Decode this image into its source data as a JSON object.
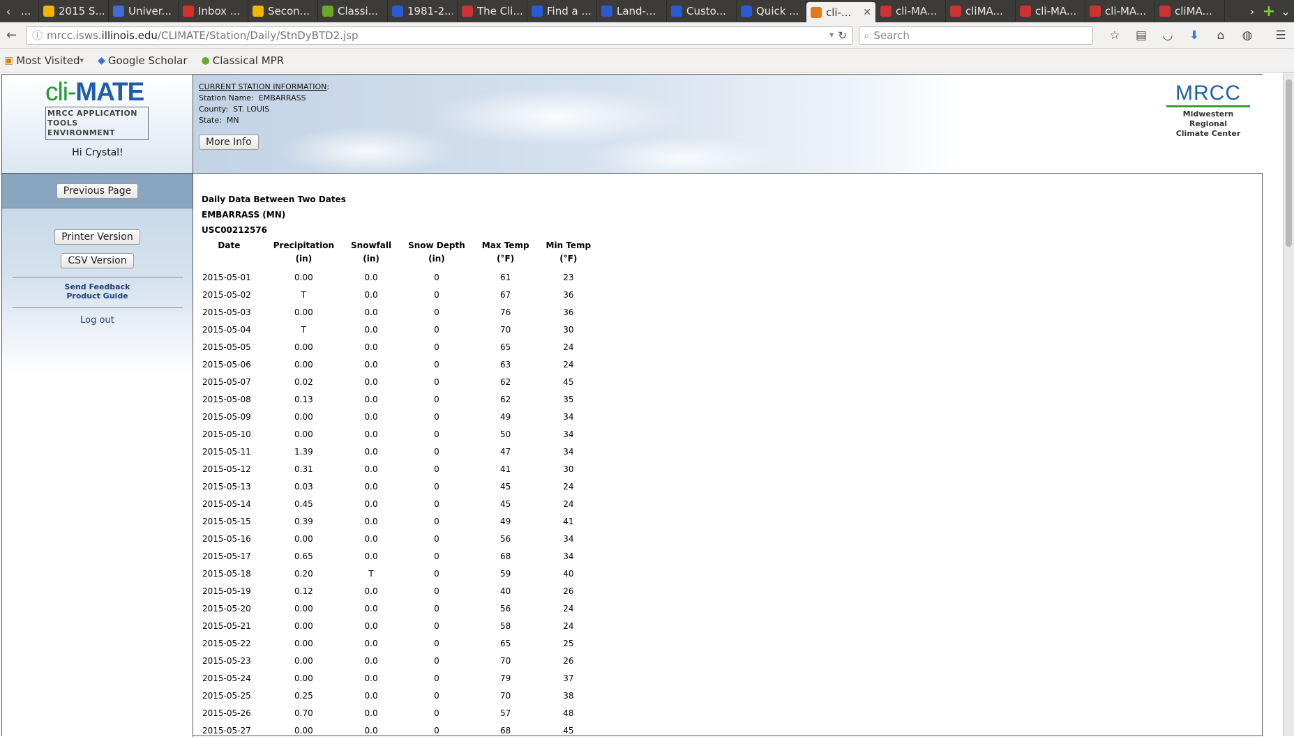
{
  "browser": {
    "tabs": [
      {
        "label": "...",
        "icon": "tab-icon",
        "color": "#888888"
      },
      {
        "label": "2015 S...",
        "icon": "google-drive-icon",
        "color": "#f4b400"
      },
      {
        "label": "Univer...",
        "icon": "calendar-icon",
        "color": "#3b6fd6"
      },
      {
        "label": "Inbox ...",
        "icon": "gmail-icon",
        "color": "#d93025"
      },
      {
        "label": "Secon...",
        "icon": "google-drive-icon",
        "color": "#f4b400"
      },
      {
        "label": "Classi...",
        "icon": "classical-mpr-icon",
        "color": "#6aa82b"
      },
      {
        "label": "1981-2...",
        "icon": "noaa-icon",
        "color": "#2a5bd7"
      },
      {
        "label": "The Cli...",
        "icon": "climate-icon",
        "color": "#cc3333"
      },
      {
        "label": "Find a ...",
        "icon": "noaa-icon",
        "color": "#2a5bd7"
      },
      {
        "label": "Land-...",
        "icon": "noaa-icon",
        "color": "#2a5bd7"
      },
      {
        "label": "Custo...",
        "icon": "noaa-icon",
        "color": "#2a5bd7"
      },
      {
        "label": "Quick ...",
        "icon": "noaa-icon",
        "color": "#2a5bd7"
      },
      {
        "label": "cli-...",
        "icon": "climate-icon",
        "color": "#e07a1a",
        "active": true
      },
      {
        "label": "cli-MA...",
        "icon": "climate-icon",
        "color": "#cc3333"
      },
      {
        "label": "cliMA...",
        "icon": "climate-icon",
        "color": "#cc3333"
      },
      {
        "label": "cli-MA...",
        "icon": "climate-icon",
        "color": "#cc3333"
      },
      {
        "label": "cli-MA...",
        "icon": "climate-icon",
        "color": "#cc3333"
      },
      {
        "label": "cliMA...",
        "icon": "climate-icon",
        "color": "#cc3333"
      }
    ],
    "close_glyph": "✕",
    "url_prefix": "mrcc.isws.",
    "url_host": "illinois.edu",
    "url_path": "/CLIMATE/Station/Daily/StnDyBTD2.jsp",
    "search_placeholder": "Search",
    "bookmarks": [
      {
        "label": "Most Visited",
        "icon": "folder-icon"
      },
      {
        "label": "Google Scholar",
        "icon": "google-scholar-icon"
      },
      {
        "label": "Classical MPR",
        "icon": "classical-mpr-icon"
      }
    ]
  },
  "site": {
    "logo_prefix": "cli-",
    "logo_suffix": "MATE",
    "logo_subtitle_line1": "MRCC APPLICATION",
    "logo_subtitle_line2": "TOOLS ENVIRONMENT",
    "greeting": "Hi Crystal!",
    "station_header": "CURRENT STATION INFORMATION",
    "station_header_colon": ":",
    "station_name_label": "Station Name:",
    "station_name": "EMBARRASS",
    "county_label": "County:",
    "county": "ST. LOUIS",
    "state_label": "State:",
    "state": "MN",
    "more_info": "More Info",
    "mrcc_logo": "MRCC",
    "mrcc_line1": "Midwestern Regional",
    "mrcc_line2": "Climate Center"
  },
  "sidebar": {
    "previous_page": "Previous Page",
    "printer_version": "Printer Version",
    "csv_version": "CSV Version",
    "send_feedback": "Send Feedback",
    "product_guide": "Product Guide",
    "log_out": "Log out"
  },
  "report": {
    "title": "Daily Data Between Two Dates",
    "station": "EMBARRASS (MN)",
    "station_id": "USC00212576",
    "columns": [
      {
        "line1": "Date",
        "line2": ""
      },
      {
        "line1": "Precipitation",
        "line2": "(in)"
      },
      {
        "line1": "Snowfall",
        "line2": "(in)"
      },
      {
        "line1": "Snow Depth",
        "line2": "(in)"
      },
      {
        "line1": "Max Temp",
        "line2": "(°F)"
      },
      {
        "line1": "Min Temp",
        "line2": "(°F)"
      }
    ],
    "rows": [
      [
        "2015-05-01",
        "0.00",
        "0.0",
        "0",
        "61",
        "23"
      ],
      [
        "2015-05-02",
        "T",
        "0.0",
        "0",
        "67",
        "36"
      ],
      [
        "2015-05-03",
        "0.00",
        "0.0",
        "0",
        "76",
        "36"
      ],
      [
        "2015-05-04",
        "T",
        "0.0",
        "0",
        "70",
        "30"
      ],
      [
        "2015-05-05",
        "0.00",
        "0.0",
        "0",
        "65",
        "24"
      ],
      [
        "2015-05-06",
        "0.00",
        "0.0",
        "0",
        "63",
        "24"
      ],
      [
        "2015-05-07",
        "0.02",
        "0.0",
        "0",
        "62",
        "45"
      ],
      [
        "2015-05-08",
        "0.13",
        "0.0",
        "0",
        "62",
        "35"
      ],
      [
        "2015-05-09",
        "0.00",
        "0.0",
        "0",
        "49",
        "34"
      ],
      [
        "2015-05-10",
        "0.00",
        "0.0",
        "0",
        "50",
        "34"
      ],
      [
        "2015-05-11",
        "1.39",
        "0.0",
        "0",
        "47",
        "34"
      ],
      [
        "2015-05-12",
        "0.31",
        "0.0",
        "0",
        "41",
        "30"
      ],
      [
        "2015-05-13",
        "0.03",
        "0.0",
        "0",
        "45",
        "24"
      ],
      [
        "2015-05-14",
        "0.45",
        "0.0",
        "0",
        "45",
        "24"
      ],
      [
        "2015-05-15",
        "0.39",
        "0.0",
        "0",
        "49",
        "41"
      ],
      [
        "2015-05-16",
        "0.00",
        "0.0",
        "0",
        "56",
        "34"
      ],
      [
        "2015-05-17",
        "0.65",
        "0.0",
        "0",
        "68",
        "34"
      ],
      [
        "2015-05-18",
        "0.20",
        "T",
        "0",
        "59",
        "40"
      ],
      [
        "2015-05-19",
        "0.12",
        "0.0",
        "0",
        "40",
        "26"
      ],
      [
        "2015-05-20",
        "0.00",
        "0.0",
        "0",
        "56",
        "24"
      ],
      [
        "2015-05-21",
        "0.00",
        "0.0",
        "0",
        "58",
        "24"
      ],
      [
        "2015-05-22",
        "0.00",
        "0.0",
        "0",
        "65",
        "25"
      ],
      [
        "2015-05-23",
        "0.00",
        "0.0",
        "0",
        "70",
        "26"
      ],
      [
        "2015-05-24",
        "0.00",
        "0.0",
        "0",
        "79",
        "37"
      ],
      [
        "2015-05-25",
        "0.25",
        "0.0",
        "0",
        "70",
        "38"
      ],
      [
        "2015-05-26",
        "0.70",
        "0.0",
        "0",
        "57",
        "48"
      ],
      [
        "2015-05-27",
        "0.00",
        "0.0",
        "0",
        "68",
        "45"
      ]
    ]
  }
}
